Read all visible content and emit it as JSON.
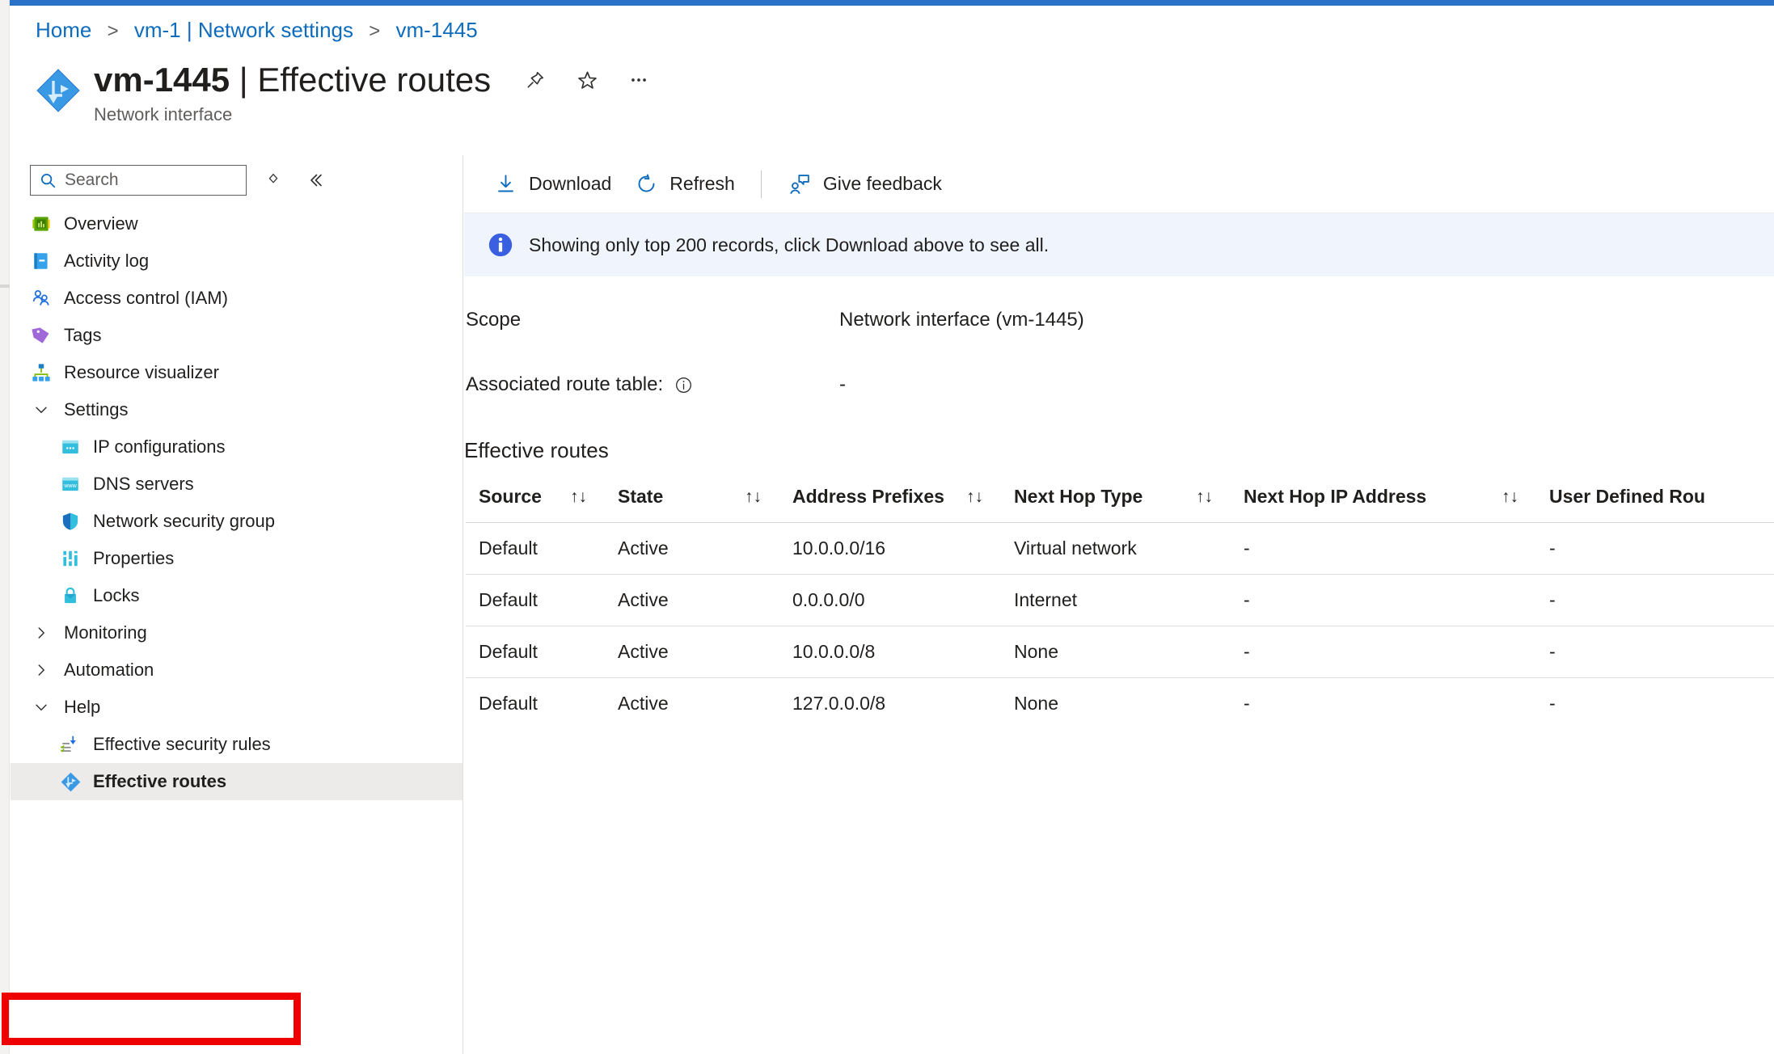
{
  "theme": {
    "accent": "#0f6cbd",
    "top_strip": "#2a72c8",
    "banner_bg": "#eff4fd",
    "selected_bg": "#edebe9",
    "highlight_border": "#ef0000"
  },
  "breadcrumb": {
    "items": [
      "Home",
      "vm-1 | Network settings",
      "vm-1445"
    ],
    "separator": ">"
  },
  "header": {
    "resource_name": "vm-1445",
    "page_name": "Effective routes",
    "title_separator": "|",
    "subtitle": "Network interface",
    "actions": [
      {
        "name": "pin-icon",
        "label": "Pin"
      },
      {
        "name": "favorite-star-icon",
        "label": "Favorite"
      },
      {
        "name": "more-ellipsis-icon",
        "label": "More"
      }
    ]
  },
  "sidebar": {
    "search": {
      "placeholder": "Search",
      "value": ""
    },
    "tools": [
      {
        "name": "expand-collapse-icon",
        "label": "Expand/Collapse"
      },
      {
        "name": "collapse-menu-icon",
        "label": "Collapse menu"
      }
    ],
    "items": [
      {
        "label": "Overview",
        "icon": "overview-icon",
        "type": "item",
        "selected": false
      },
      {
        "label": "Activity log",
        "icon": "activity-log-icon",
        "type": "item",
        "selected": false
      },
      {
        "label": "Access control (IAM)",
        "icon": "access-control-icon",
        "type": "item",
        "selected": false
      },
      {
        "label": "Tags",
        "icon": "tags-icon",
        "type": "item",
        "selected": false
      },
      {
        "label": "Resource visualizer",
        "icon": "resource-visualizer-icon",
        "type": "item",
        "selected": false
      },
      {
        "label": "Settings",
        "icon": "chevron-down-icon",
        "type": "group-open",
        "selected": false
      },
      {
        "label": "IP configurations",
        "icon": "ip-configurations-icon",
        "type": "sub",
        "selected": false
      },
      {
        "label": "DNS servers",
        "icon": "dns-servers-icon",
        "type": "sub",
        "selected": false
      },
      {
        "label": "Network security group",
        "icon": "shield-icon",
        "type": "sub",
        "selected": false
      },
      {
        "label": "Properties",
        "icon": "properties-icon",
        "type": "sub",
        "selected": false
      },
      {
        "label": "Locks",
        "icon": "lock-icon",
        "type": "sub",
        "selected": false
      },
      {
        "label": "Monitoring",
        "icon": "chevron-right-icon",
        "type": "group-closed",
        "selected": false
      },
      {
        "label": "Automation",
        "icon": "chevron-right-icon",
        "type": "group-closed",
        "selected": false
      },
      {
        "label": "Help",
        "icon": "chevron-down-icon",
        "type": "group-open",
        "selected": false
      },
      {
        "label": "Effective security rules",
        "icon": "effective-security-rules-icon",
        "type": "sub",
        "selected": false
      },
      {
        "label": "Effective routes",
        "icon": "effective-routes-icon",
        "type": "sub",
        "selected": true
      }
    ]
  },
  "command_bar": {
    "buttons": [
      {
        "label": "Download",
        "icon": "download-icon"
      },
      {
        "label": "Refresh",
        "icon": "refresh-icon"
      },
      {
        "label": "Give feedback",
        "icon": "give-feedback-icon"
      }
    ],
    "separator_after_index": 1
  },
  "info_banner": {
    "icon": "info-icon",
    "message": "Showing only top 200 records, click Download above to see all."
  },
  "details": [
    {
      "label": "Scope",
      "value": "Network interface (vm-1445)",
      "has_info_icon": false
    },
    {
      "label": "Associated route table:",
      "value": "-",
      "has_info_icon": true
    }
  ],
  "routes_section": {
    "title": "Effective routes",
    "sort_glyph": "↑↓",
    "columns": [
      {
        "label": "Source",
        "sortable": true
      },
      {
        "label": "State",
        "sortable": true
      },
      {
        "label": "Address Prefixes",
        "sortable": true
      },
      {
        "label": "Next Hop Type",
        "sortable": true
      },
      {
        "label": "Next Hop IP Address",
        "sortable": true
      },
      {
        "label": "User Defined Rou",
        "sortable": false
      }
    ],
    "rows": [
      {
        "source": "Default",
        "state": "Active",
        "address_prefixes": "10.0.0.0/16",
        "next_hop_type": "Virtual network",
        "next_hop_ip": "-",
        "user_defined_route": "-"
      },
      {
        "source": "Default",
        "state": "Active",
        "address_prefixes": "0.0.0.0/0",
        "next_hop_type": "Internet",
        "next_hop_ip": "-",
        "user_defined_route": "-"
      },
      {
        "source": "Default",
        "state": "Active",
        "address_prefixes": "10.0.0.0/8",
        "next_hop_type": "None",
        "next_hop_ip": "-",
        "user_defined_route": "-"
      },
      {
        "source": "Default",
        "state": "Active",
        "address_prefixes": "127.0.0.0/8",
        "next_hop_type": "None",
        "next_hop_ip": "-",
        "user_defined_route": "-"
      }
    ]
  }
}
